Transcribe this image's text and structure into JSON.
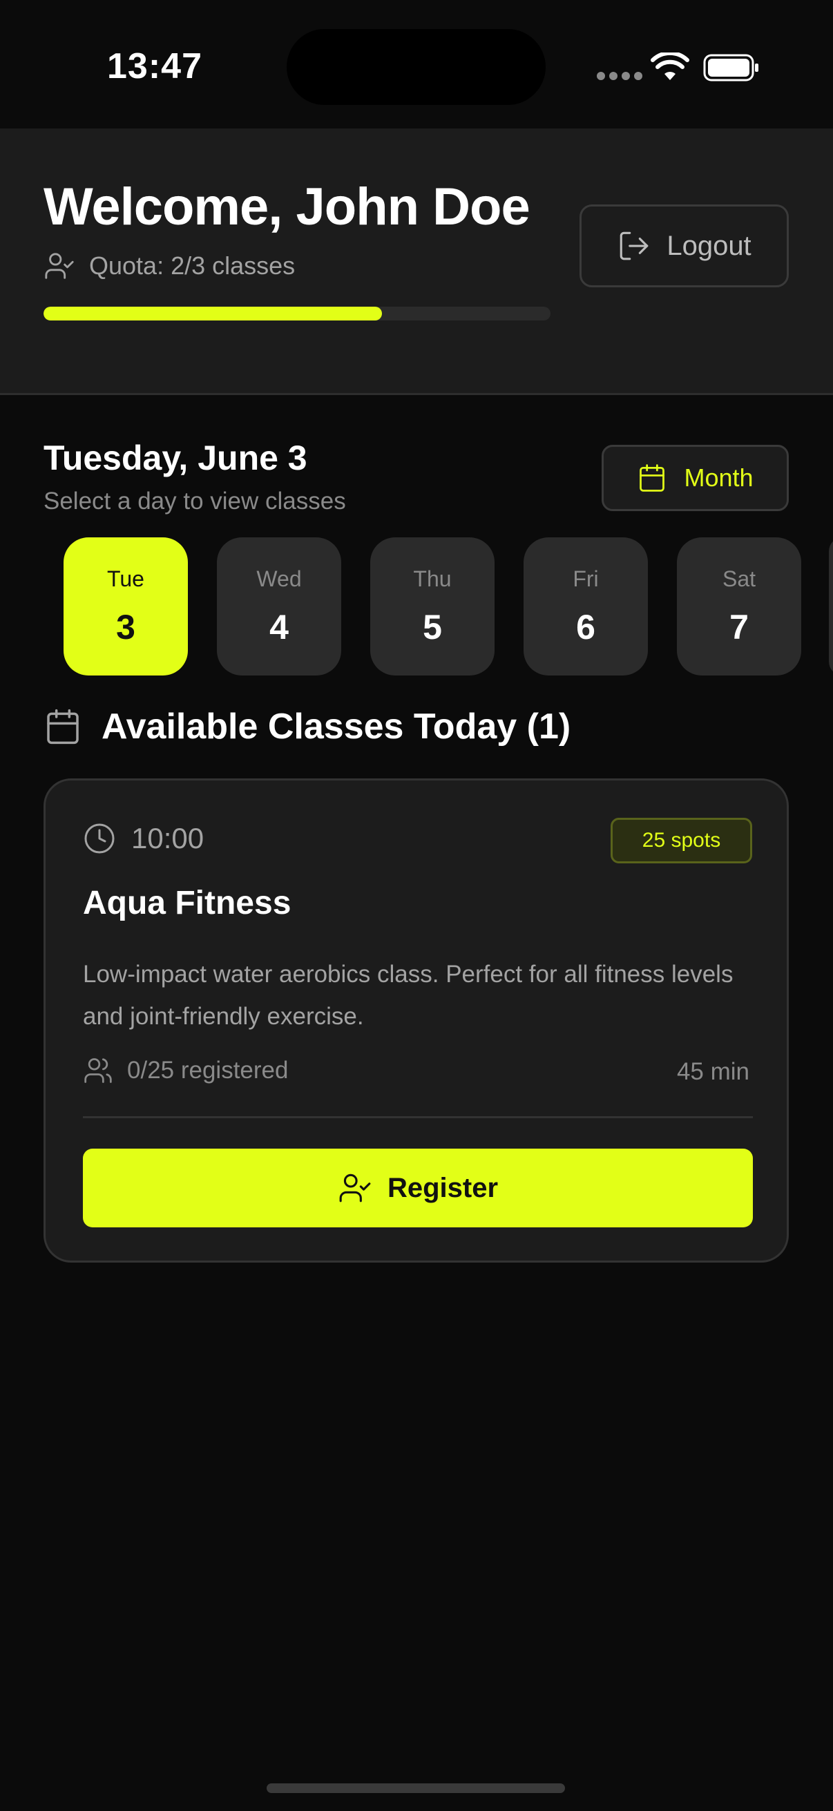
{
  "status_bar": {
    "time": "13:47"
  },
  "header": {
    "welcome": "Welcome, John Doe",
    "quota_text": "Quota: 2/3 classes",
    "quota_progress": 0.667,
    "logout_label": "Logout"
  },
  "date_section": {
    "title": "Tuesday, June 3",
    "subtitle": "Select a day to view classes",
    "month_label": "Month",
    "days": [
      {
        "name": "Tue",
        "num": "3",
        "active": true
      },
      {
        "name": "Wed",
        "num": "4",
        "active": false
      },
      {
        "name": "Thu",
        "num": "5",
        "active": false
      },
      {
        "name": "Fri",
        "num": "6",
        "active": false
      },
      {
        "name": "Sat",
        "num": "7",
        "active": false
      }
    ]
  },
  "classes": {
    "heading": "Available Classes Today (1)",
    "items": [
      {
        "time": "10:00",
        "spots": "25 spots",
        "name": "Aqua Fitness",
        "description": "Low-impact water aerobics class. Perfect for all fitness levels and joint-friendly exercise.",
        "registered": "0/25 registered",
        "duration": "45 min",
        "register_label": "Register"
      }
    ]
  },
  "colors": {
    "accent": "#e2ff17",
    "background": "#0b0b0b",
    "card": "#1c1c1c",
    "chip": "#2b2b2b"
  },
  "icons": {
    "quota": "user-check-icon",
    "logout": "logout-icon",
    "month": "calendar-icon",
    "classes": "calendar-icon",
    "time": "clock-icon",
    "registered": "users-icon",
    "register": "user-check-icon"
  }
}
